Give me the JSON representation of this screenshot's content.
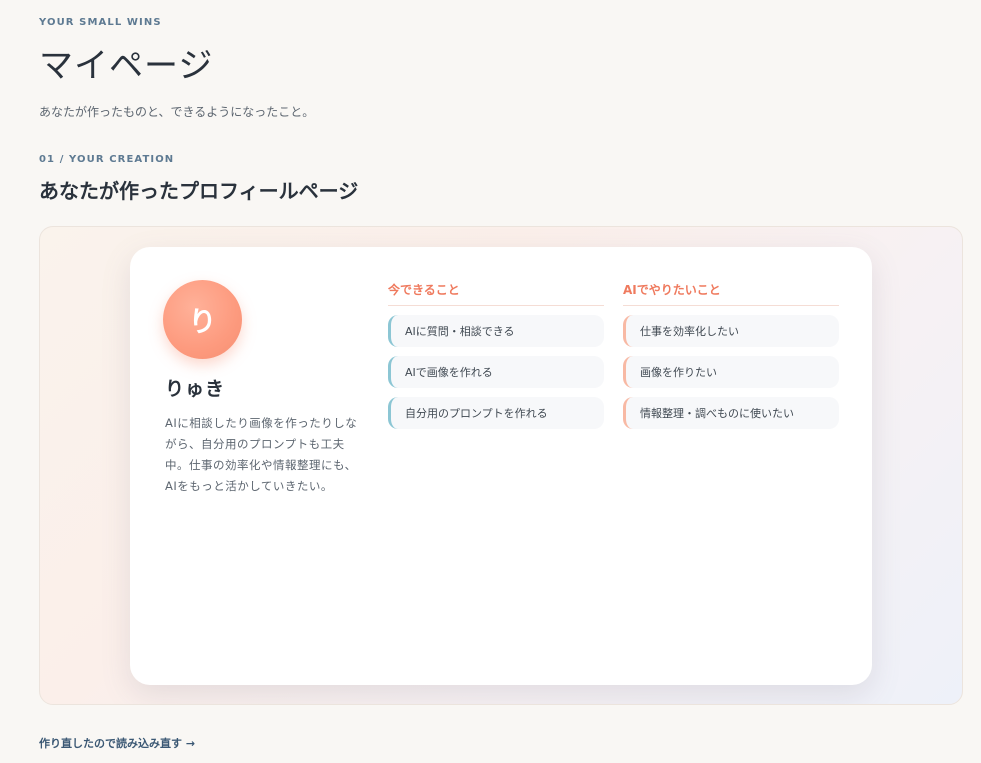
{
  "header": {
    "eyebrow": "YOUR SMALL WINS",
    "title": "マイページ",
    "subtitle": "あなたが作ったものと、できるようになったこと。"
  },
  "section": {
    "eyebrow": "01 / YOUR CREATION",
    "title": "あなたが作ったプロフィールページ"
  },
  "profile": {
    "avatar_initial": "り",
    "name": "りゅき",
    "bio": "AIに相談したり画像を作ったりしながら、自分用のプロンプトも工夫中。仕事の効率化や情報整理にも、AIをもっと活かしていきたい。",
    "can_do": {
      "heading": "今できること",
      "items": [
        {
          "label": "AIに質問・相談できる"
        },
        {
          "label": "AIで画像を作れる"
        },
        {
          "label": "自分用のプロンプトを作れる"
        }
      ]
    },
    "want_to_do": {
      "heading": "AIでやりたいこと",
      "items": [
        {
          "label": "仕事を効率化したい"
        },
        {
          "label": "画像を作りたい"
        },
        {
          "label": "情報整理・調べものに使いたい"
        }
      ]
    }
  },
  "footer": {
    "reload_link": "作り直したので読み込み直す →"
  },
  "colors": {
    "background": "#f9f7f4",
    "accent_coral": "#ef7a5e",
    "accent_teal": "#8cc6d4",
    "avatar": "#fd9a7e",
    "eyebrow": "#5e7a92"
  }
}
